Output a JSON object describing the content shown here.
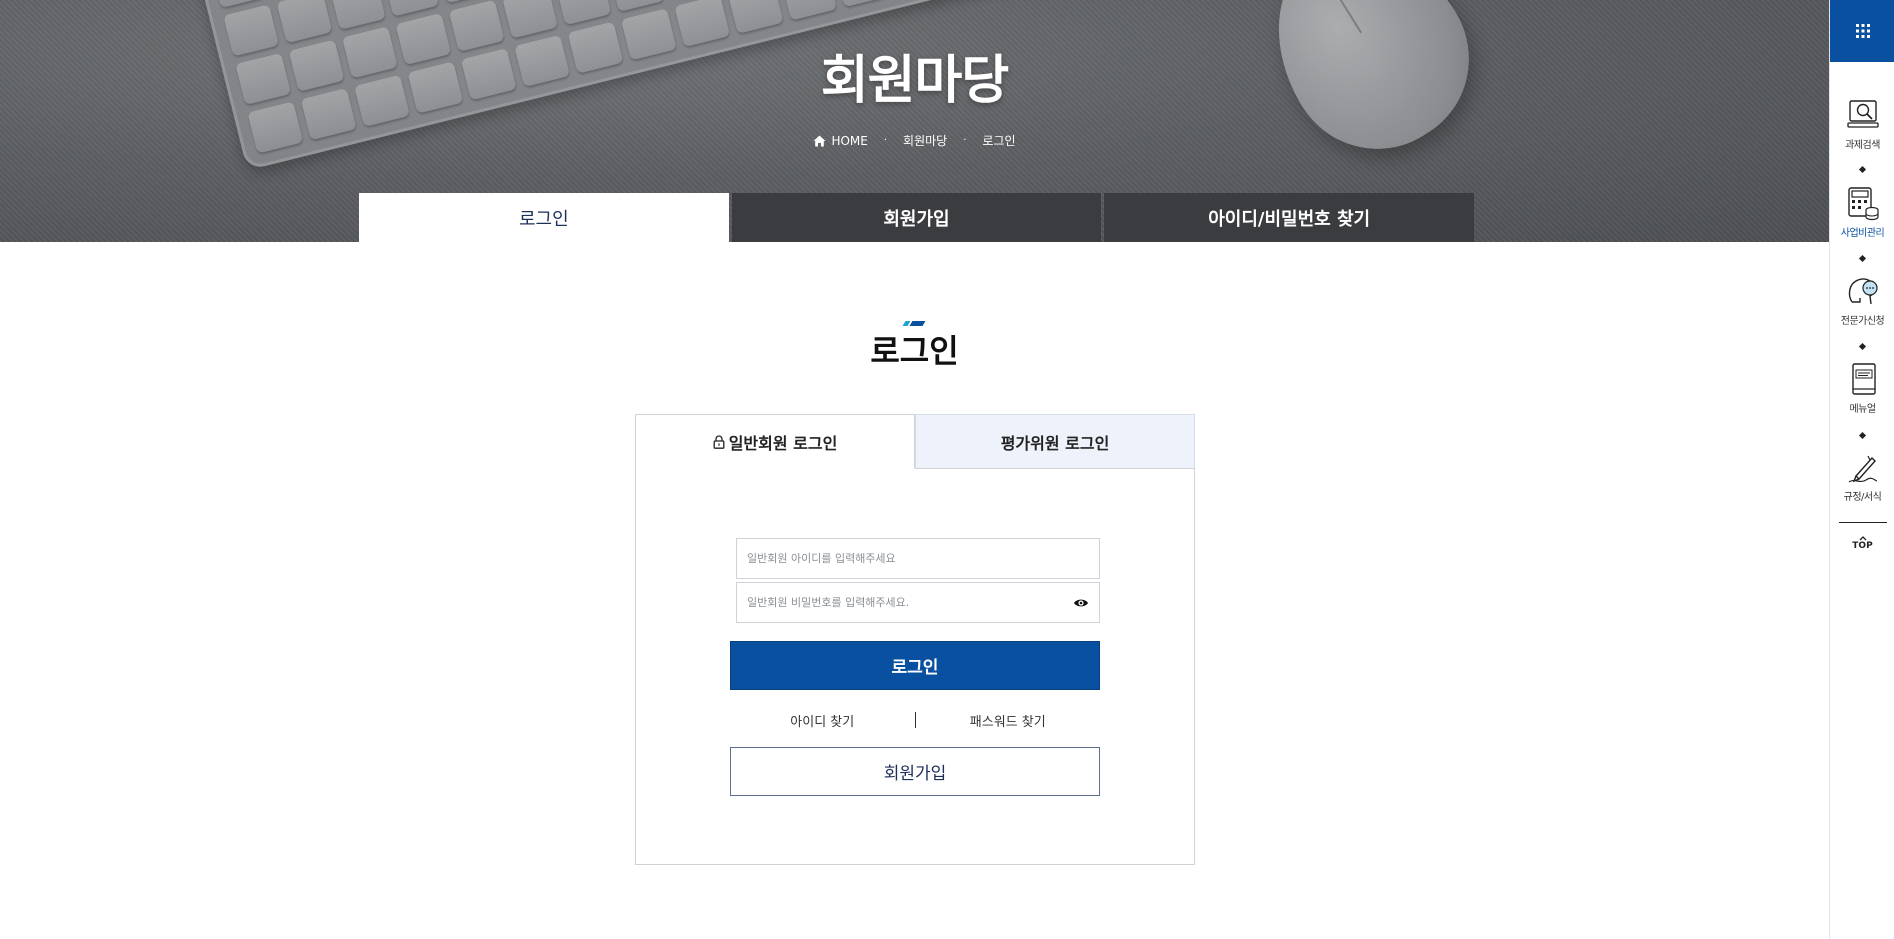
{
  "hero": {
    "title": "회원마당",
    "breadcrumb": [
      "HOME",
      "회원마당",
      "로그인"
    ]
  },
  "main_tabs": [
    {
      "label": "로그인",
      "active": true
    },
    {
      "label": "회원가입",
      "active": false
    },
    {
      "label": "아이디/비밀번호 찾기",
      "active": false
    }
  ],
  "section": {
    "title": "로그인"
  },
  "login": {
    "tabs": [
      {
        "label": "일반회원 로그인",
        "icon": "lock-icon",
        "active": true
      },
      {
        "label": "평가위원 로그인",
        "active": false
      }
    ],
    "id_placeholder": "일반회원 아이디를 입력해주세요",
    "pw_placeholder": "일반회원 비밀번호를 입력해주세요.",
    "login_button": "로그인",
    "find_id": "아이디 찾기",
    "find_pw": "패스워드 찾기",
    "join_button": "회원가입"
  },
  "quickbar": {
    "menu_icon": "grid-icon",
    "items": [
      {
        "label": "과제검색",
        "icon": "search-monitor-icon",
        "highlight": false
      },
      {
        "label": "사업비관리",
        "icon": "calculator-icon",
        "highlight": true
      },
      {
        "label": "전문가신청",
        "icon": "expert-icon",
        "highlight": false
      },
      {
        "label": "메뉴얼",
        "icon": "book-icon",
        "highlight": false
      },
      {
        "label": "규정/서식",
        "icon": "pen-icon",
        "highlight": false
      }
    ],
    "top_label": "TOP"
  },
  "colors": {
    "primary": "#0a50a1",
    "dark_tab": "#3b3c40",
    "light_tab": "#eef3fb",
    "title_navy": "#1d2f5a"
  }
}
